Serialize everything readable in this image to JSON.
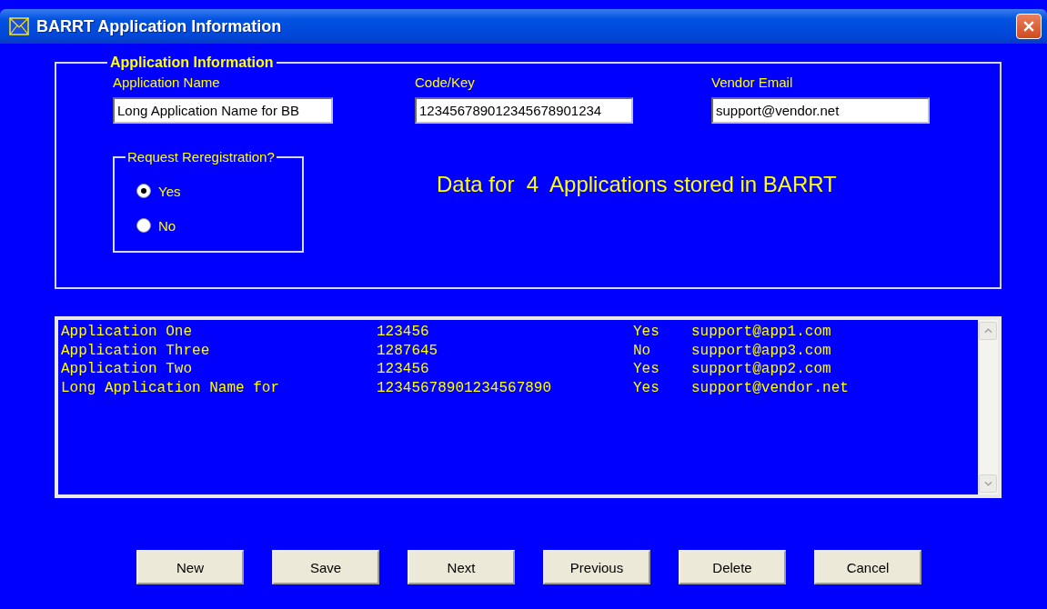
{
  "window": {
    "title": "BARRT Application Information"
  },
  "group": {
    "title": "Application Information",
    "fields": [
      {
        "label": "Application Name",
        "value": "Long Application Name for BB"
      },
      {
        "label": "Code/Key",
        "value": "123456789012345678901234"
      },
      {
        "label": "Vendor Email",
        "value": "support@vendor.net"
      }
    ],
    "reregistration": {
      "title": "Request Reregistration?",
      "options": [
        {
          "label": "Yes",
          "selected": true
        },
        {
          "label": "No",
          "selected": false
        }
      ]
    },
    "summary": "Data for  4  Applications stored in BARRT"
  },
  "list": {
    "rows": [
      {
        "cells": [
          "Application One",
          "123456",
          "Yes",
          "support@app1.com"
        ]
      },
      {
        "cells": [
          "Application Three",
          "1287645",
          "No",
          "support@app3.com"
        ]
      },
      {
        "cells": [
          "Application Two",
          "123456",
          "Yes",
          "support@app2.com"
        ]
      },
      {
        "cells": [
          "Long Application Name for",
          "12345678901234567890",
          "Yes",
          "support@vendor.net"
        ]
      }
    ]
  },
  "buttons": [
    "New",
    "Save",
    "Next",
    "Previous",
    "Delete",
    "Cancel"
  ]
}
